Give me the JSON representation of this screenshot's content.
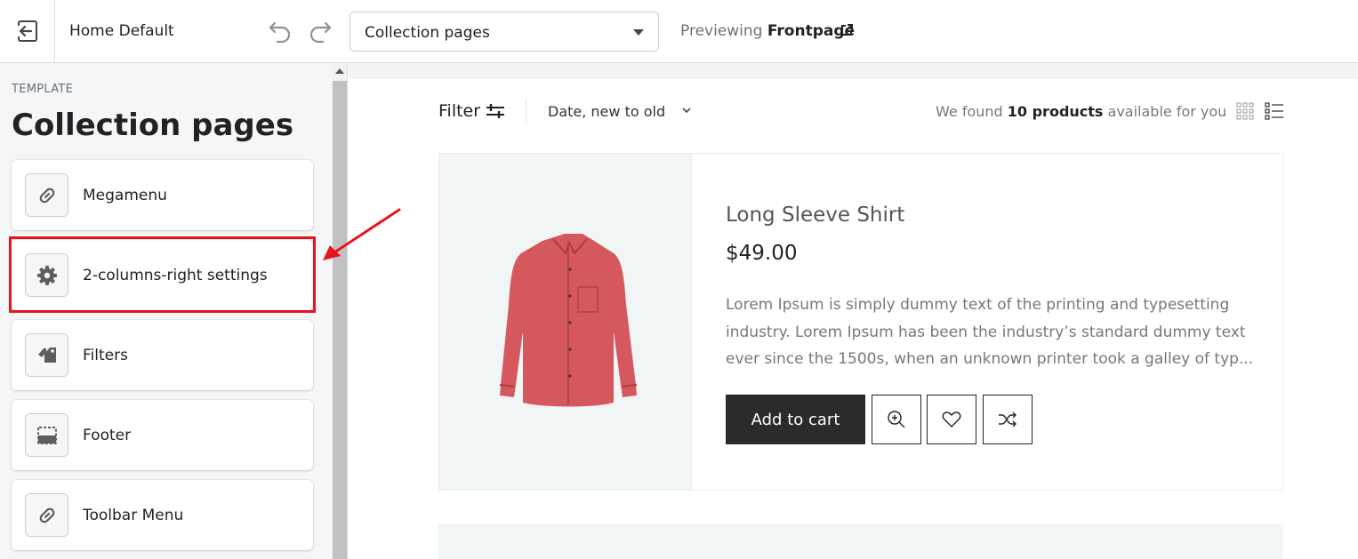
{
  "topbar": {
    "theme_name": "Home Default",
    "template_select": "Collection pages",
    "previewing_prefix": "Previewing",
    "previewing_page": "Frontpage"
  },
  "sidebar": {
    "section_label": "TEMPLATE",
    "title": "Collection pages",
    "items": [
      {
        "label": "Megamenu",
        "icon": "link-icon"
      },
      {
        "label": "2-columns-right settings",
        "icon": "gear-icon"
      },
      {
        "label": "Filters",
        "icon": "tags-icon"
      },
      {
        "label": "Footer",
        "icon": "footer-icon"
      },
      {
        "label": "Toolbar Menu",
        "icon": "link-icon"
      }
    ],
    "highlighted_item": "2-columns-right settings",
    "highlight_color": "#e8141c"
  },
  "preview": {
    "filter_label": "Filter",
    "sort_label": "Date, new to old",
    "found_prefix": "We found",
    "found_count": "10 products",
    "found_suffix": "available for you",
    "product": {
      "title": "Long Sleeve Shirt",
      "price": "$49.00",
      "description": "Lorem Ipsum is simply dummy text of the printing and typesetting industry. Lorem Ipsum has been the industry’s standard dummy text ever since the 1500s, when an unknown printer took a galley of typ...",
      "add_to_cart": "Add to cart",
      "shirt_color": "#d4585d"
    }
  }
}
